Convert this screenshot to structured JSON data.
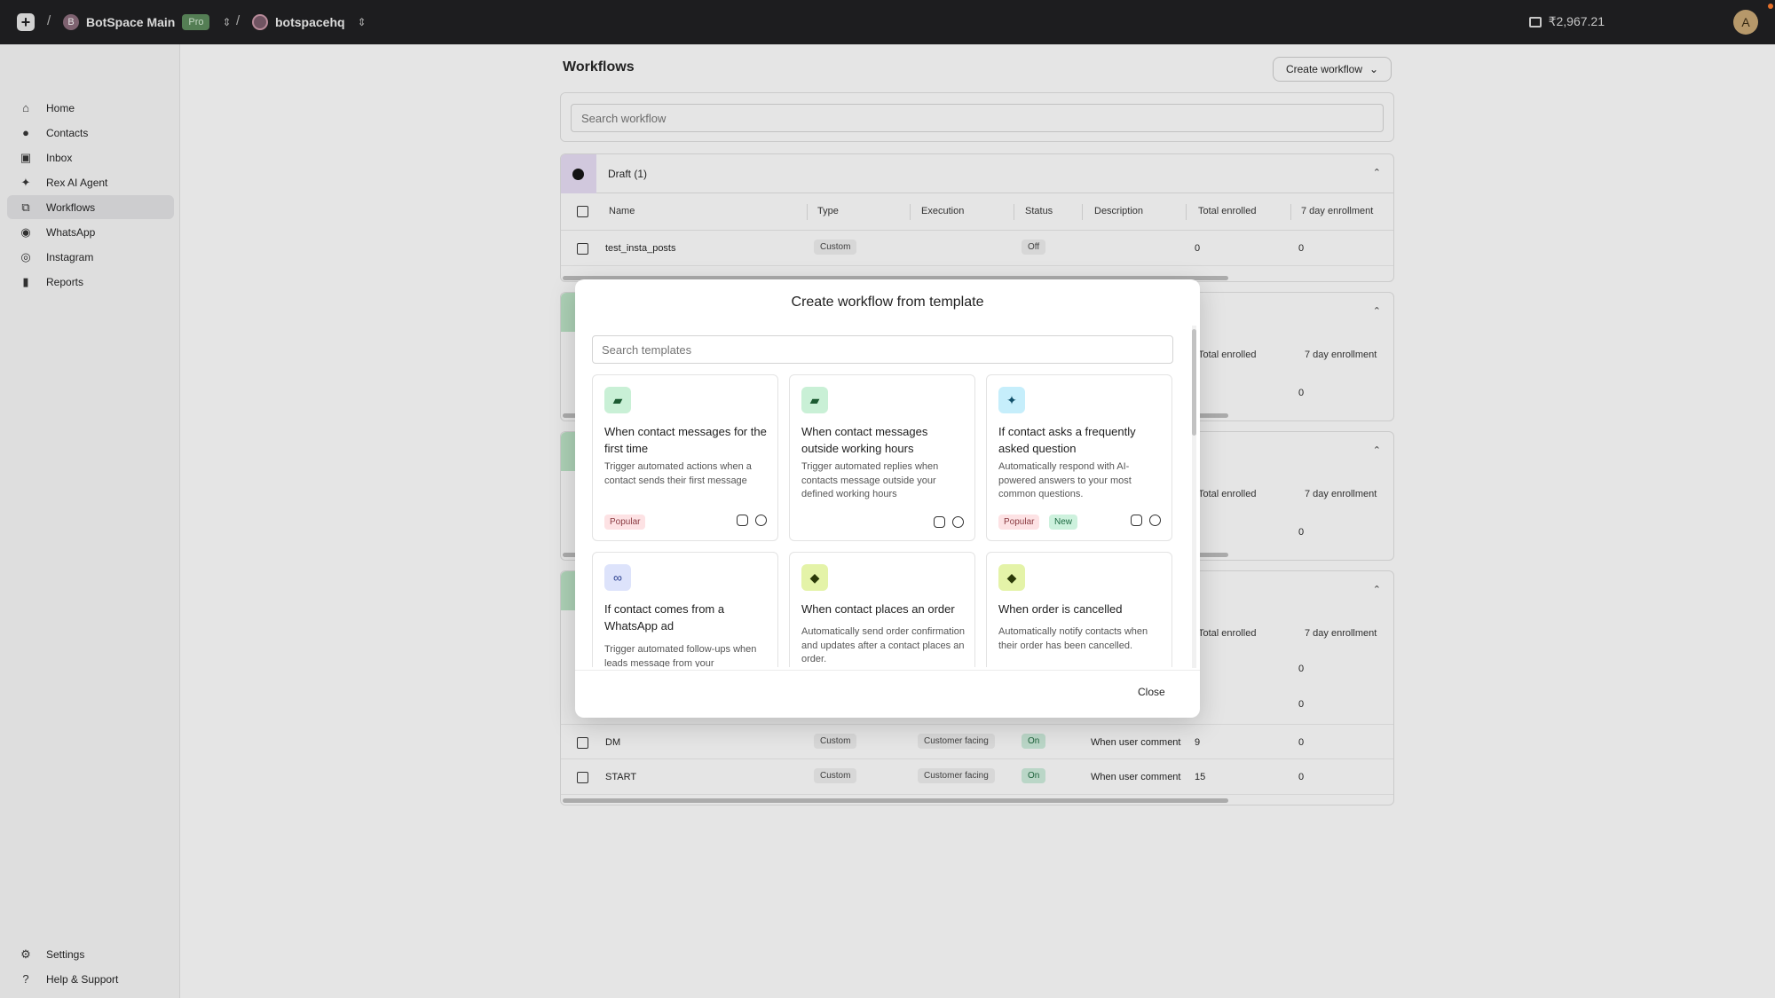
{
  "topbar": {
    "workspace": {
      "initial": "B",
      "name": "BotSpace Main",
      "plan": "Pro"
    },
    "account": {
      "name": "botspacehq"
    },
    "balance": "₹2,967.21",
    "user_initial": "A"
  },
  "sidebar": {
    "items": [
      {
        "label": "Home",
        "icon": "home-icon"
      },
      {
        "label": "Contacts",
        "icon": "user-icon"
      },
      {
        "label": "Inbox",
        "icon": "inbox-icon"
      },
      {
        "label": "Rex AI Agent",
        "icon": "sparkle-icon"
      },
      {
        "label": "Workflows",
        "icon": "workflow-icon",
        "active": true
      },
      {
        "label": "WhatsApp",
        "icon": "whatsapp-icon"
      },
      {
        "label": "Instagram",
        "icon": "instagram-icon"
      },
      {
        "label": "Reports",
        "icon": "bar-chart-icon"
      }
    ],
    "bottom": [
      {
        "label": "Settings",
        "icon": "gear-icon"
      },
      {
        "label": "Help & Support",
        "icon": "help-icon"
      }
    ]
  },
  "main": {
    "title": "Workflows",
    "create_label": "Create workflow",
    "search_placeholder": "Search workflow",
    "columns": [
      "Name",
      "Type",
      "Execution",
      "Status",
      "Description",
      "Total enrolled",
      "7 day enrollment"
    ],
    "draft": {
      "title": "Draft (1)",
      "rows": [
        {
          "name": "test_insta_posts",
          "type": "Custom",
          "execution": "",
          "status": "Off",
          "description": "",
          "total": "0",
          "week": "0"
        }
      ]
    },
    "partial_headers": {
      "total": "Total enrolled",
      "week": "7 day enrollment"
    },
    "partial_values": [
      "0",
      "0",
      "0",
      "0",
      "0"
    ],
    "bottom_rows": [
      {
        "name": "DM",
        "type": "Custom",
        "execution": "Customer facing",
        "status": "On",
        "description": "When user comment",
        "total": "9",
        "week": "0"
      },
      {
        "name": "START",
        "type": "Custom",
        "execution": "Customer facing",
        "status": "On",
        "description": "When user comment",
        "total": "15",
        "week": "0"
      }
    ]
  },
  "modal": {
    "title": "Create workflow from template",
    "search_placeholder": "Search templates",
    "close_label": "Close",
    "templates": [
      {
        "title": "When contact messages for the first time",
        "desc": "Trigger automated actions when a contact sends their first message",
        "icon": "chat-icon",
        "badges": [
          "Popular"
        ]
      },
      {
        "title": "When contact messages outside working hours",
        "desc": "Trigger automated replies when contacts message outside your defined working hours",
        "icon": "chat-icon",
        "badges": []
      },
      {
        "title": "If contact asks a frequently asked question",
        "desc": "Automatically respond with AI-powered answers to your most common questions.",
        "icon": "sparkle-icon",
        "badges": [
          "Popular",
          "New"
        ]
      },
      {
        "title": "If contact comes from a WhatsApp ad",
        "desc": "Trigger automated follow-ups when leads message from your",
        "icon": "meta-icon",
        "badges": []
      },
      {
        "title": "When contact places an order",
        "desc": "Automatically send order confirmation and updates after a contact places an order.",
        "icon": "shopify-icon",
        "badges": []
      },
      {
        "title": "When order is cancelled",
        "desc": "Automatically notify contacts when their order has been cancelled.",
        "icon": "shopify-icon",
        "badges": []
      }
    ]
  },
  "colors": {
    "accent_green": "#cfeedd",
    "draft_purple": "#e9def6",
    "popular": "#fde2e4"
  }
}
